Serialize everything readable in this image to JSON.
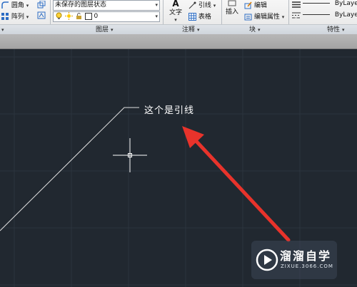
{
  "ribbon": {
    "modify": {
      "fillet": "圆角",
      "array": "阵列"
    },
    "layers": {
      "state_value": "未保存的图层状态",
      "current_layer": "0",
      "panel_label": "图层"
    },
    "annotation": {
      "text": "文字",
      "leader": "引线",
      "table": "表格",
      "panel_label": "注释"
    },
    "block": {
      "insert": "插入",
      "edit": "编辑",
      "edit_attributes": "编辑属性",
      "panel_label": "块"
    },
    "properties": {
      "linetype1": "ByLaye",
      "linetype2": "ByLaye",
      "panel_label": "特性"
    }
  },
  "canvas": {
    "leader_text": "这个是引线"
  },
  "watermark": {
    "title": "溜溜自学",
    "url": "ZIXUE.3066.COM"
  },
  "colors": {
    "canvas": "#212830",
    "arrow": "#e8332b",
    "leader": "#e0e0e0"
  }
}
